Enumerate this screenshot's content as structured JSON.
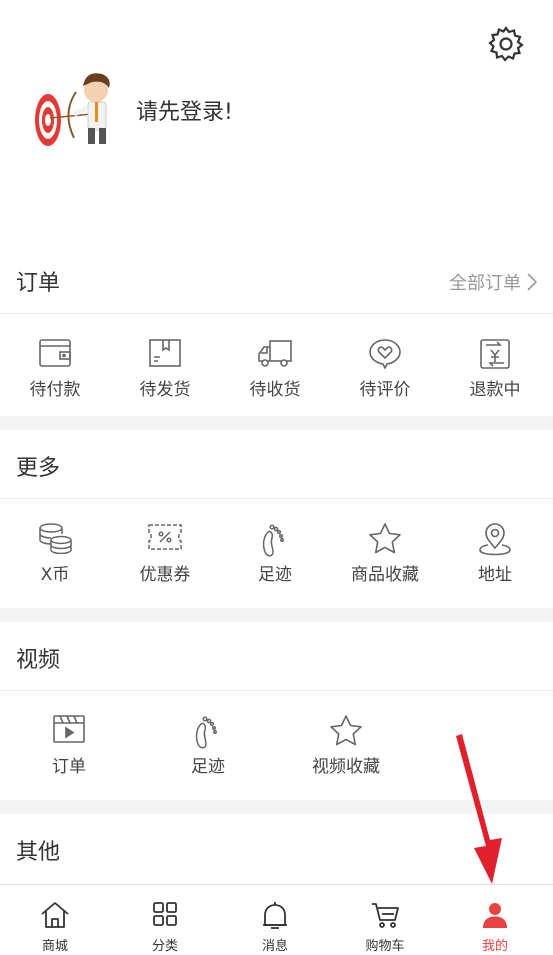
{
  "header": {
    "login_prompt": "请先登录!"
  },
  "orders": {
    "title": "订单",
    "all_link": "全部订单",
    "items": [
      {
        "label": "待付款",
        "icon": "wallet-icon"
      },
      {
        "label": "待发货",
        "icon": "package-icon"
      },
      {
        "label": "待收货",
        "icon": "truck-icon"
      },
      {
        "label": "待评价",
        "icon": "heart-chat-icon"
      },
      {
        "label": "退款中",
        "icon": "refund-icon"
      }
    ]
  },
  "more": {
    "title": "更多",
    "items": [
      {
        "label": "X币",
        "icon": "coins-icon"
      },
      {
        "label": "优惠券",
        "icon": "coupon-icon"
      },
      {
        "label": "足迹",
        "icon": "footprint-icon"
      },
      {
        "label": "商品收藏",
        "icon": "star-icon"
      },
      {
        "label": "地址",
        "icon": "location-icon"
      }
    ]
  },
  "video": {
    "title": "视频",
    "items": [
      {
        "label": "订单",
        "icon": "clapperboard-icon"
      },
      {
        "label": "足迹",
        "icon": "footprint-icon"
      },
      {
        "label": "视频收藏",
        "icon": "star-icon"
      }
    ]
  },
  "other": {
    "title": "其他"
  },
  "tabbar": {
    "items": [
      {
        "label": "商城",
        "icon": "home-icon"
      },
      {
        "label": "分类",
        "icon": "grid-icon"
      },
      {
        "label": "消息",
        "icon": "bell-icon"
      },
      {
        "label": "购物车",
        "icon": "cart-icon"
      },
      {
        "label": "我的",
        "icon": "user-icon",
        "active": true
      }
    ],
    "active_color": "#e64340"
  }
}
